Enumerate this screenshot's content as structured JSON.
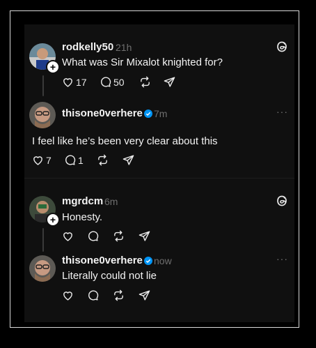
{
  "posts": [
    {
      "username": "rodkelly50",
      "time": "21h",
      "text": "What was Sir Mixalot knighted for?",
      "likes": "17",
      "replies": "50"
    },
    {
      "username": "thisone0verhere",
      "time": "7m",
      "text": "I feel like he’s been very clear about this",
      "likes": "7",
      "replies": "1",
      "verified": true
    },
    {
      "username": "mgrdcm",
      "time": "6m",
      "text": "Honesty."
    },
    {
      "username": "thisone0verhere",
      "time": "now",
      "text": "Literally could not lie",
      "verified": true
    }
  ],
  "colors": {
    "background": "#101010",
    "text": "#f3f3f3",
    "muted": "#6f6f6f",
    "verified": "#0095f6"
  },
  "icons": [
    "threads-icon",
    "heart-icon",
    "comment-icon",
    "repost-icon",
    "share-icon",
    "verified-icon",
    "more-icon"
  ]
}
